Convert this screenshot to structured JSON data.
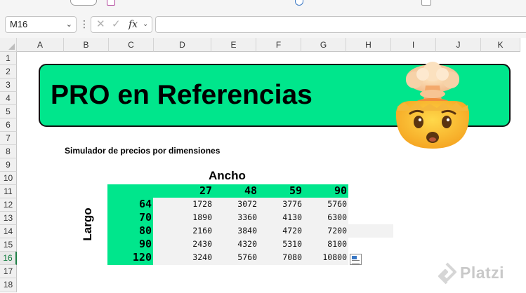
{
  "formula_bar": {
    "name_box": "M16",
    "fx_label": "fx",
    "formula": ""
  },
  "columns": [
    "A",
    "B",
    "C",
    "D",
    "E",
    "F",
    "G",
    "H",
    "I",
    "J",
    "K"
  ],
  "rows": [
    "1",
    "2",
    "3",
    "4",
    "5",
    "6",
    "7",
    "8",
    "9",
    "10",
    "11",
    "12",
    "13",
    "14",
    "15",
    "16",
    "17",
    "18"
  ],
  "active_row": "16",
  "sheet": {
    "banner_title": "PRO en Referencias",
    "banner_emoji": "exploding-head-emoji",
    "subtitle": "Simulador de precios por dimensiones",
    "ancho_label": "Ancho",
    "largo_label": "Largo",
    "col_values": [
      "27",
      "48",
      "59",
      "90"
    ],
    "row_values": [
      "64",
      "70",
      "80",
      "90",
      "120"
    ],
    "matrix": [
      [
        "1728",
        "3072",
        "3776",
        "5760"
      ],
      [
        "1890",
        "3360",
        "4130",
        "6300"
      ],
      [
        "2160",
        "3840",
        "4720",
        "7200"
      ],
      [
        "2430",
        "4320",
        "5310",
        "8100"
      ],
      [
        "3240",
        "5760",
        "7080",
        "10800"
      ]
    ]
  },
  "watermark": {
    "text": "Platzi"
  },
  "colors": {
    "accent_green": "#00e68c",
    "cell_gray": "#f2f2f2",
    "header_bg": "#f0f0f0"
  }
}
